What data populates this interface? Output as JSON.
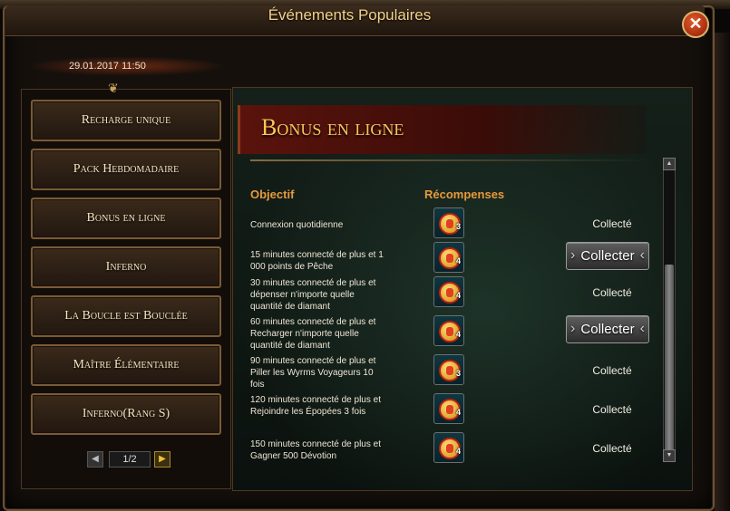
{
  "window": {
    "title": "Événements Populaires"
  },
  "date": "29.01.2017 11:50",
  "sidebar": {
    "items": [
      {
        "label": "Recharge unique"
      },
      {
        "label": "Pack Hebdomadaire"
      },
      {
        "label": "Bonus en ligne"
      },
      {
        "label": "Inferno"
      },
      {
        "label": "La Boucle est Bouclée"
      },
      {
        "label": "Maître Élémentaire"
      },
      {
        "label": "Inferno(Rang S)"
      }
    ],
    "pager": "1/2"
  },
  "main": {
    "banner": "Bonus en ligne",
    "col_objectif": "Objectif",
    "col_recompenses": "Récompenses",
    "rows": [
      {
        "objective": "Connexion quotidienne",
        "reward_count": "3",
        "status": "Collecté"
      },
      {
        "objective": "15 minutes connecté de plus et 1 000 points de Pêche",
        "reward_count": "4",
        "status": "Collecter"
      },
      {
        "objective": "30 minutes connecté de plus et dépenser n'importe quelle quantité de diamant",
        "reward_count": "4",
        "status": "Collecté"
      },
      {
        "objective": "60 minutes connecté de plus et Recharger n'importe quelle quantité de diamant",
        "reward_count": "4",
        "status": "Collecter"
      },
      {
        "objective": "90 minutes connecté de plus et Piller les Wyrms Voyageurs 10 fois",
        "reward_count": "3",
        "status": "Collecté"
      },
      {
        "objective": "120 minutes connecté de plus et Rejoindre les Épopées 3 fois",
        "reward_count": "4",
        "status": "Collecté"
      },
      {
        "objective": "150 minutes connecté de plus et Gagner 500 Dévotion",
        "reward_count": "4",
        "status": "Collecté"
      }
    ]
  },
  "icons": {
    "close": "close-icon",
    "reward": "coin-icon",
    "prev": "arrow-left-icon",
    "next": "arrow-right-icon"
  }
}
